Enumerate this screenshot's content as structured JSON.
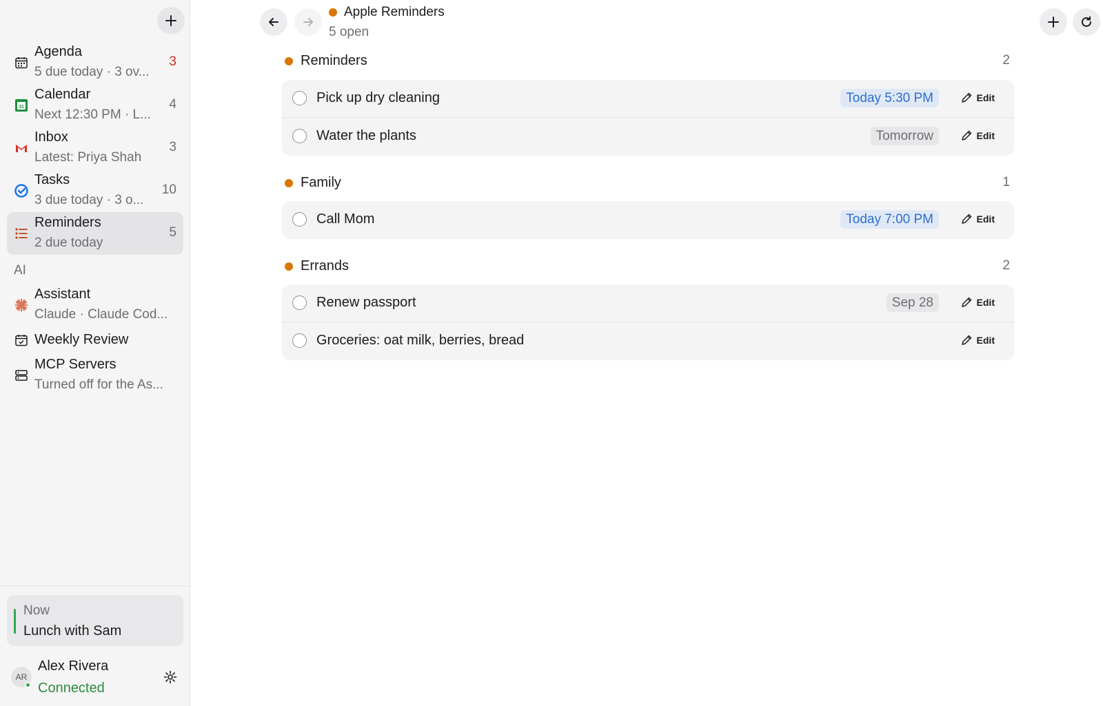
{
  "sidebar": {
    "items": [
      {
        "title": "Agenda",
        "subtitle": "5 due today · 3 ov...",
        "count": "3",
        "icon": "calendar-grid-icon"
      },
      {
        "title": "Calendar",
        "subtitle": "Next 12:30 PM · L...",
        "count": "4",
        "icon": "google-calendar-icon"
      },
      {
        "title": "Inbox",
        "subtitle": "Latest: Priya Shah",
        "count": "3",
        "icon": "gmail-icon"
      },
      {
        "title": "Tasks",
        "subtitle": "3 due today · 3 o...",
        "count": "10",
        "icon": "tasks-check-icon"
      },
      {
        "title": "Reminders",
        "subtitle": "2 due today",
        "count": "5",
        "icon": "list-icon"
      }
    ],
    "section_ai": "AI",
    "ai_items": [
      {
        "title": "Assistant",
        "subtitle": "Claude · Claude Cod...",
        "icon": "claude-icon"
      },
      {
        "title": "Weekly Review",
        "icon": "calendar-review-icon"
      },
      {
        "title": "MCP Servers",
        "subtitle": "Turned off for the As...",
        "icon": "server-icon"
      }
    ],
    "now": {
      "label": "Now",
      "title": "Lunch with Sam"
    },
    "user": {
      "initials": "AR",
      "name": "Alex Rivera",
      "status": "Connected"
    }
  },
  "header": {
    "title": "Apple Reminders",
    "subtitle": "5 open"
  },
  "groups": [
    {
      "name": "Reminders",
      "count": "2",
      "items": [
        {
          "title": "Pick up dry cleaning",
          "due": "Today 5:30 PM",
          "due_style": "today",
          "edit": "Edit"
        },
        {
          "title": "Water the plants",
          "due": "Tomorrow",
          "due_style": "plain",
          "edit": "Edit"
        }
      ]
    },
    {
      "name": "Family",
      "count": "1",
      "items": [
        {
          "title": "Call Mom",
          "due": "Today 7:00 PM",
          "due_style": "today",
          "edit": "Edit"
        }
      ]
    },
    {
      "name": "Errands",
      "count": "2",
      "items": [
        {
          "title": "Renew passport",
          "due": "Sep 28",
          "due_style": "plain",
          "edit": "Edit"
        },
        {
          "title": "Groceries: oat milk, berries, bread",
          "due": "",
          "due_style": "none",
          "edit": "Edit"
        }
      ]
    }
  ],
  "colors": {
    "accent": "#d97706",
    "today_blue": "#2f6dd0",
    "connected_green": "#2e8b3e",
    "alert_red": "#c9302c"
  }
}
